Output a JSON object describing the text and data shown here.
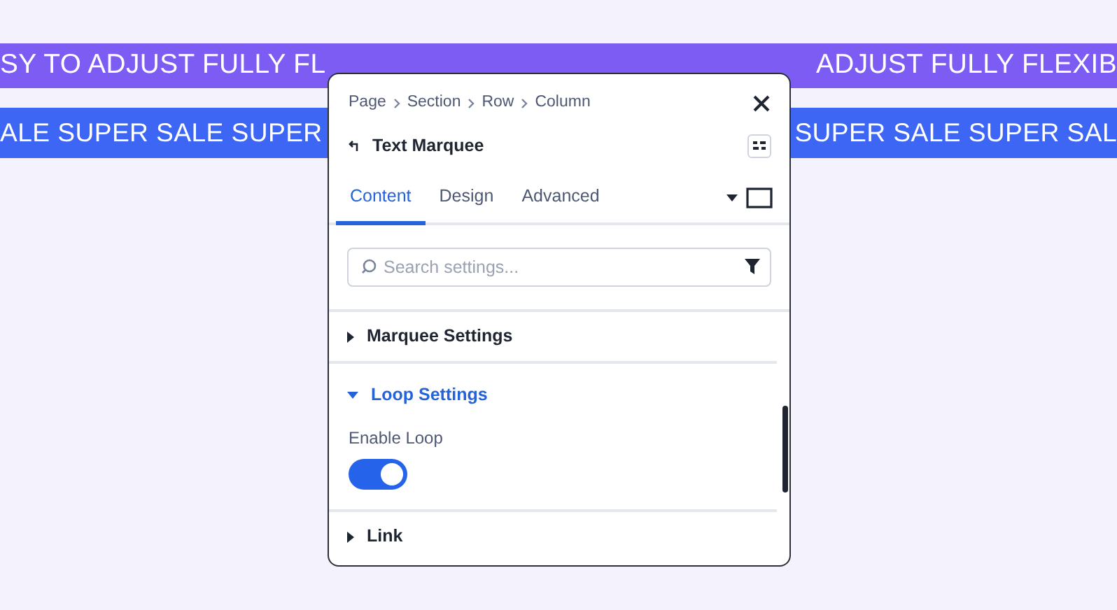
{
  "marquee_bars": [
    {
      "color": "#7c5cf3",
      "texts": [
        "SY TO ADJUST FULLY FL",
        "ADJUST FULLY FLEXIB"
      ]
    },
    {
      "color": "#3d66f5",
      "texts": [
        "ALE SUPER SALE SUPER",
        "SUPER SALE SUPER SAL"
      ]
    }
  ],
  "panel": {
    "breadcrumb": [
      "Page",
      "Section",
      "Row",
      "Column"
    ],
    "title": "Text Marquee",
    "tabs": [
      {
        "label": "Content",
        "selected": true
      },
      {
        "label": "Design",
        "selected": false
      },
      {
        "label": "Advanced",
        "selected": false
      }
    ],
    "search": {
      "placeholder": "Search settings..."
    },
    "sections": [
      {
        "label": "Marquee Settings",
        "expanded": false
      },
      {
        "label": "Loop Settings",
        "expanded": true,
        "fields": [
          {
            "kind": "toggle",
            "label": "Enable Loop",
            "on": true
          }
        ]
      },
      {
        "label": "Link",
        "expanded": false
      }
    ]
  }
}
